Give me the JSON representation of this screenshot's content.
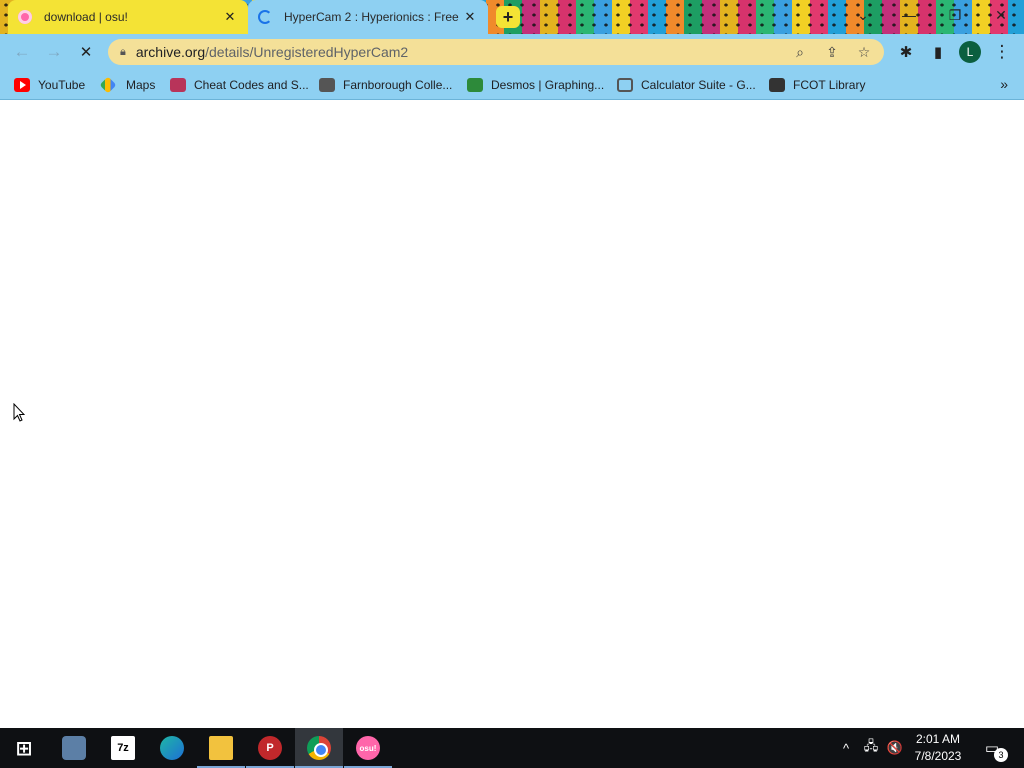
{
  "browser": {
    "tabs": [
      {
        "title": "download | osu!",
        "close": "✕",
        "favicon": "osu-icon"
      },
      {
        "title": "HyperCam 2 : Hyperionics : Free",
        "close": "✕",
        "favicon": "loading-spinner-icon"
      }
    ],
    "new_tab": "+",
    "window_controls": {
      "tab_search": "⌄",
      "minimize": "—",
      "restore": "❐",
      "close": "✕"
    },
    "nav": {
      "back": "←",
      "forward": "→",
      "reload": "✕"
    },
    "address": {
      "host": "archive.org",
      "path": "/details/UnregisteredHyperCam2"
    },
    "toolbar_icons": {
      "search": "🔍",
      "share": "⇪",
      "star": "☆",
      "extensions": "✱",
      "side_panel": "▮",
      "profile": "L",
      "menu": "⋮"
    },
    "bookmarks": [
      {
        "label": "YouTube",
        "icon": "youtube-icon"
      },
      {
        "label": "Maps",
        "icon": "maps-icon"
      },
      {
        "label": "Cheat Codes and S...",
        "icon": "cheat-codes-icon"
      },
      {
        "label": "Farnborough Colle...",
        "icon": "farnborough-icon"
      },
      {
        "label": "Desmos | Graphing...",
        "icon": "desmos-icon"
      },
      {
        "label": "Calculator Suite - G...",
        "icon": "geogebra-icon"
      },
      {
        "label": "FCOT Library",
        "icon": "globe-icon"
      }
    ],
    "bookmarks_more": "»"
  },
  "taskbar": {
    "start": "⊞",
    "apps": [
      "App launcher",
      "7z",
      "Microsoft Edge",
      "File Explorer",
      "P",
      "Google Chrome",
      "osu!"
    ],
    "labels": {
      "7z": "7z",
      "pp": "P",
      "osu": "osu!"
    },
    "tray": {
      "chevron": "^",
      "network": "🖧",
      "volume": "🔇"
    },
    "time": "2:01 AM",
    "date": "7/8/2023",
    "notifications": "3"
  }
}
